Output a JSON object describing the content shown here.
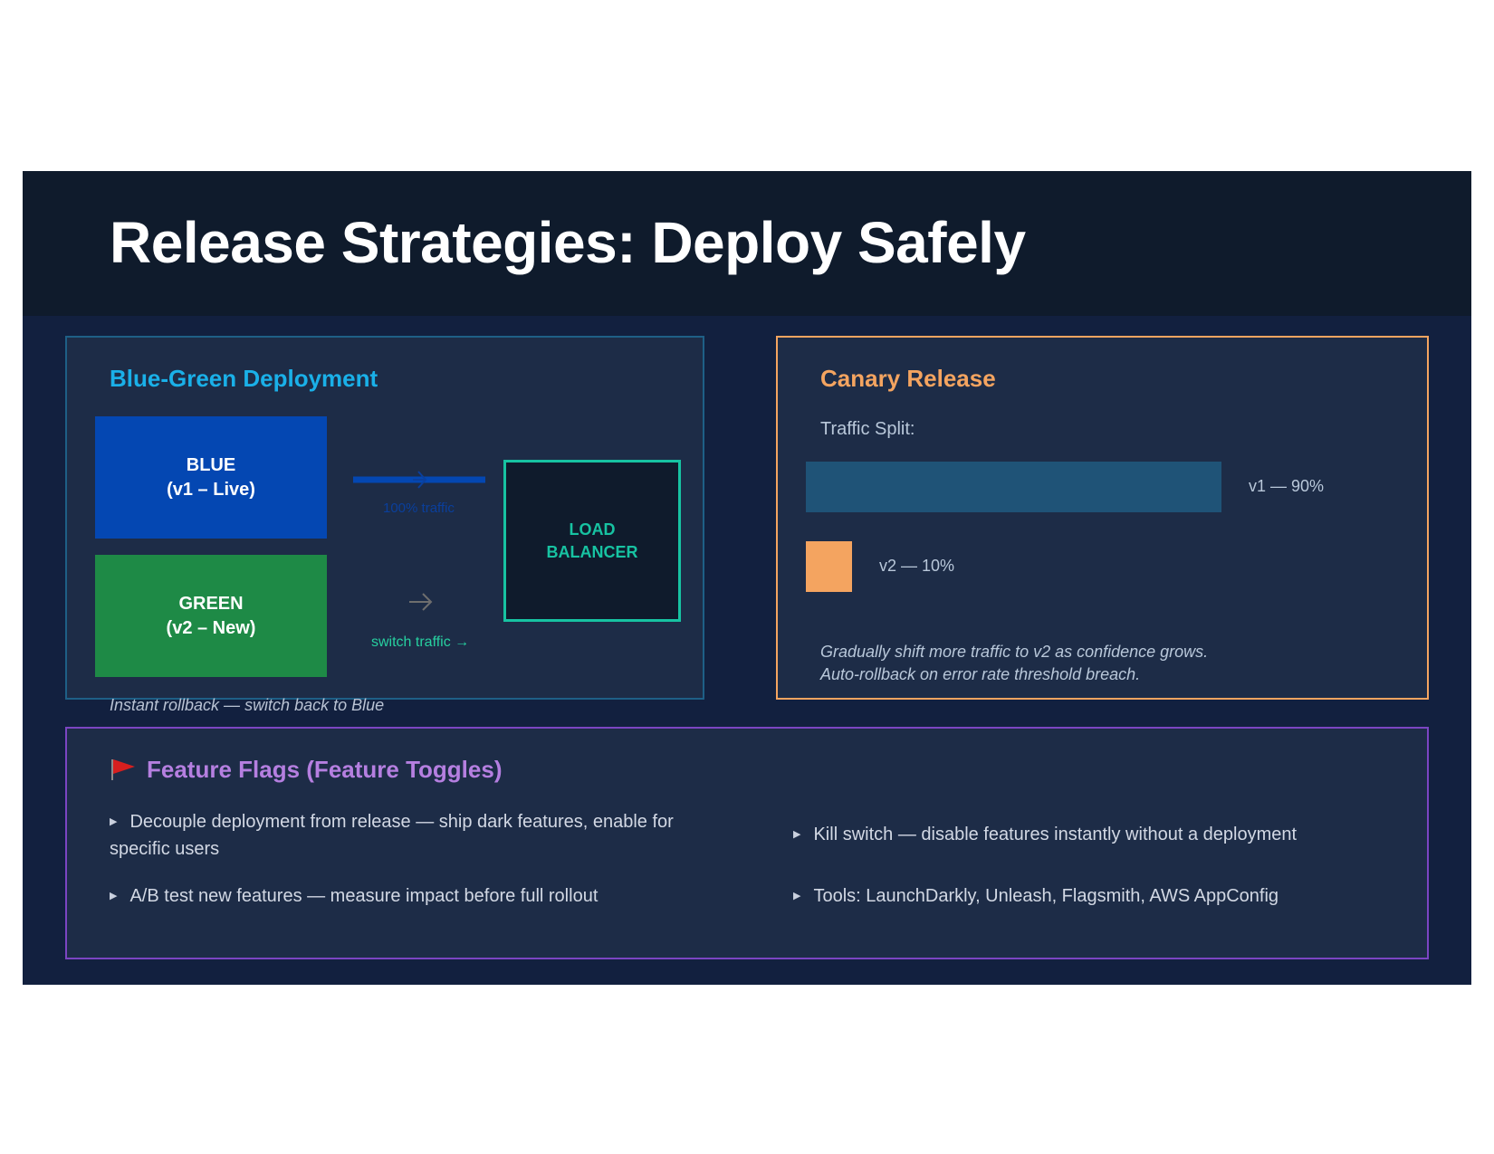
{
  "slide": {
    "title": "Release Strategies: Deploy Safely"
  },
  "blue_green": {
    "title": "Blue-Green Deployment",
    "blue_label": "BLUE\n(v1 – Live)",
    "green_label": "GREEN\n(v2 – New)",
    "lb_label": "LOAD\nBALANCER",
    "traffic_label": "100% traffic",
    "switch_label": "switch traffic →",
    "rollback_note": "Instant rollback — switch back to Blue",
    "colors": {
      "blue": "#0447b2",
      "green": "#1e8a46",
      "lb_border": "#17c3a2",
      "accent": "#1ab0e8"
    }
  },
  "canary": {
    "title": "Canary Release",
    "split_label": "Traffic Split:",
    "v1_label": "v1 — 90%",
    "v2_label": "v2 — 10%",
    "v1_share": 0.9,
    "v2_share": 0.1,
    "note_line1": "Gradually shift more traffic to v2 as confidence grows.",
    "note_line2": "Auto-rollback on error rate threshold breach.",
    "colors": {
      "v1": "#1f5377",
      "v2": "#f4a460",
      "accent": "#f4a460"
    }
  },
  "feature_flags": {
    "icon": "red-flag-icon",
    "title": "Feature Flags (Feature Toggles)",
    "bullets": [
      "Decouple deployment from release — ship dark features, enable for specific users",
      "A/B test new features — measure impact before full rollout",
      "Kill switch — disable features instantly without a deployment",
      "Tools: LaunchDarkly, Unleash, Flagsmith, AWS AppConfig"
    ],
    "colors": {
      "accent": "#b57fe0",
      "border": "#7b45c2"
    }
  }
}
